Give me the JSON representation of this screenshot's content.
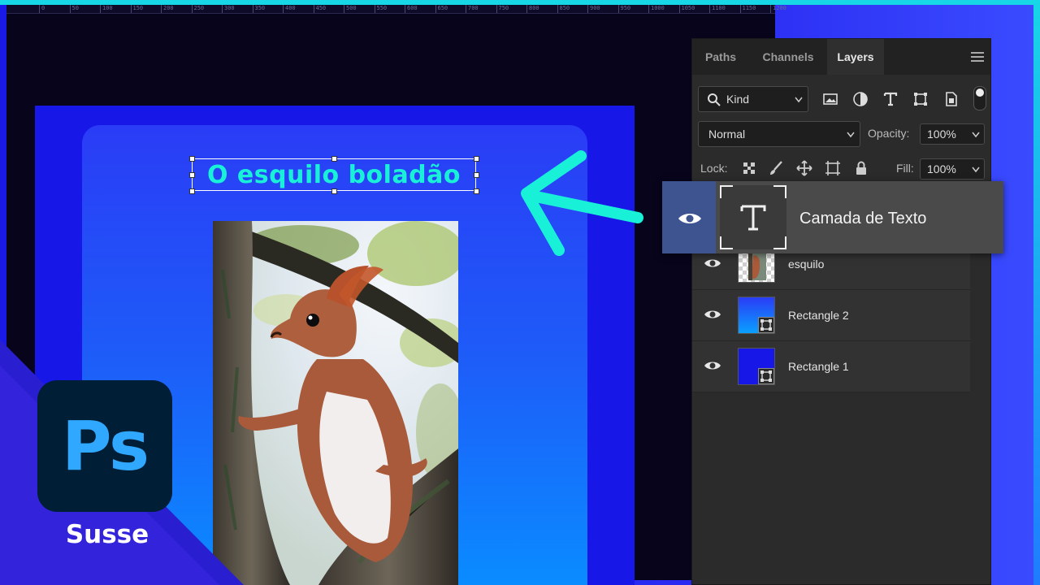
{
  "canvas": {
    "ruler_labels": [
      "0",
      "50",
      "100",
      "150",
      "200",
      "250",
      "300",
      "350",
      "400",
      "450",
      "500",
      "550",
      "600",
      "650",
      "700",
      "750",
      "800",
      "850",
      "900",
      "950",
      "1000",
      "1050",
      "1100",
      "1150",
      "1200"
    ],
    "title_text": "O esquilo boladão"
  },
  "panel": {
    "tabs": [
      {
        "label": "Paths",
        "active": false
      },
      {
        "label": "Channels",
        "active": false
      },
      {
        "label": "Layers",
        "active": true
      }
    ],
    "filter": {
      "label": "Kind"
    },
    "blend_mode": "Normal",
    "opacity_label": "Opacity:",
    "opacity_value": "100%",
    "lock_label": "Lock:",
    "fill_label": "Fill:",
    "fill_value": "100%",
    "layers": [
      {
        "name": "Camada de Texto",
        "type": "text",
        "selected": true
      },
      {
        "name": "esquilo",
        "type": "image"
      },
      {
        "name": "Rectangle 2",
        "type": "shape"
      },
      {
        "name": "Rectangle 1",
        "type": "shape"
      }
    ]
  },
  "branding": {
    "logo_text": "Ps",
    "channel_name": "Susse"
  },
  "colors": {
    "accent_teal": "#19f0d8",
    "doc_blue": "#1717e8",
    "ps_dark": "#001e36",
    "ps_blue": "#31a8ff"
  }
}
